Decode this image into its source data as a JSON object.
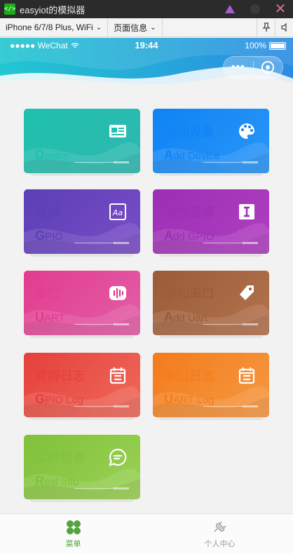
{
  "window": {
    "title": "easyiot的模拟器",
    "logo_text": "</>"
  },
  "toolbar": {
    "device": "iPhone 6/7/8 Plus, WiFi",
    "page_info": "页面信息",
    "chevron": "⌄"
  },
  "status": {
    "carrier": "●●●●● WeChat",
    "time": "19:44",
    "battery": "100%"
  },
  "capsule": {
    "dots": "•••"
  },
  "cards": [
    {
      "cn": "设备",
      "en_first": "D",
      "en_rest": "evice",
      "icon": "id-card-icon",
      "color_from": "#1fc1ad",
      "color_to": "#2fb7b0"
    },
    {
      "cn": "添加设备",
      "en_first": "A",
      "en_rest": "dd Device",
      "icon": "palette-icon",
      "color_from": "#0f83f5",
      "color_to": "#2a96f6"
    },
    {
      "cn": "管脚",
      "en_first": "G",
      "en_rest": "PIO",
      "icon": "font-icon",
      "color_from": "#5b3fb6",
      "color_to": "#7a4dc6"
    },
    {
      "cn": "添加管脚",
      "en_first": "A",
      "en_rest": "dd GPIO",
      "icon": "text-cursor-icon",
      "color_from": "#9b2fb4",
      "color_to": "#b03fc0"
    },
    {
      "cn": "串口",
      "en_first": "U",
      "en_rest": "ART",
      "icon": "voice-icon",
      "color_from": "#e23c8e",
      "color_to": "#e35fa8"
    },
    {
      "cn": "添加串口",
      "en_first": "A",
      "en_rest": "dd Uart",
      "icon": "tag-icon",
      "color_from": "#9a5b38",
      "color_to": "#b3734f"
    },
    {
      "cn": "管脚日志",
      "en_first": "G",
      "en_rest": "PIO Log",
      "icon": "calendar-icon",
      "color_from": "#e5403c",
      "color_to": "#ef6b5a"
    },
    {
      "cn": "串口日志",
      "en_first": "U",
      "en_rest": "ART Log",
      "icon": "calendar-icon",
      "color_from": "#f37b1c",
      "color_to": "#f59a43"
    },
    {
      "cn": "实时信息",
      "en_first": "R",
      "en_rest": "eal Info",
      "icon": "chat-icon",
      "color_from": "#80c13b",
      "color_to": "#9bd154"
    }
  ],
  "tabbar": {
    "items": [
      {
        "label": "菜单",
        "active": true,
        "color": "#51a43a"
      },
      {
        "label": "个人中心",
        "active": false,
        "color": "#999999"
      }
    ]
  }
}
